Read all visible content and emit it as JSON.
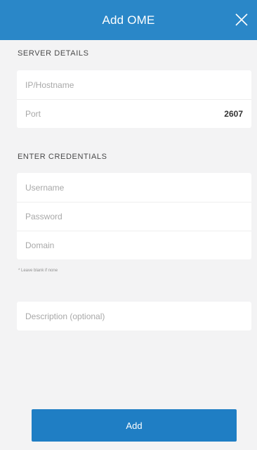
{
  "header": {
    "title": "Add OME",
    "close_icon": "close-icon"
  },
  "server_details": {
    "section_label": "SERVER DETAILS",
    "hostname": {
      "placeholder": "IP/Hostname",
      "value": ""
    },
    "port": {
      "label": "Port",
      "value": "2607"
    }
  },
  "credentials": {
    "section_label": "ENTER CREDENTIALS",
    "username": {
      "placeholder": "Username",
      "value": ""
    },
    "password": {
      "placeholder": "Password",
      "value": ""
    },
    "domain": {
      "placeholder": "Domain",
      "value": ""
    },
    "hint": "* Leave blank if none"
  },
  "description": {
    "placeholder": "Description (optional)",
    "value": ""
  },
  "actions": {
    "add_label": "Add"
  },
  "colors": {
    "header_bg": "#2a87c8",
    "button_bg": "#1f7ec4",
    "page_bg": "#f3f3f4"
  }
}
